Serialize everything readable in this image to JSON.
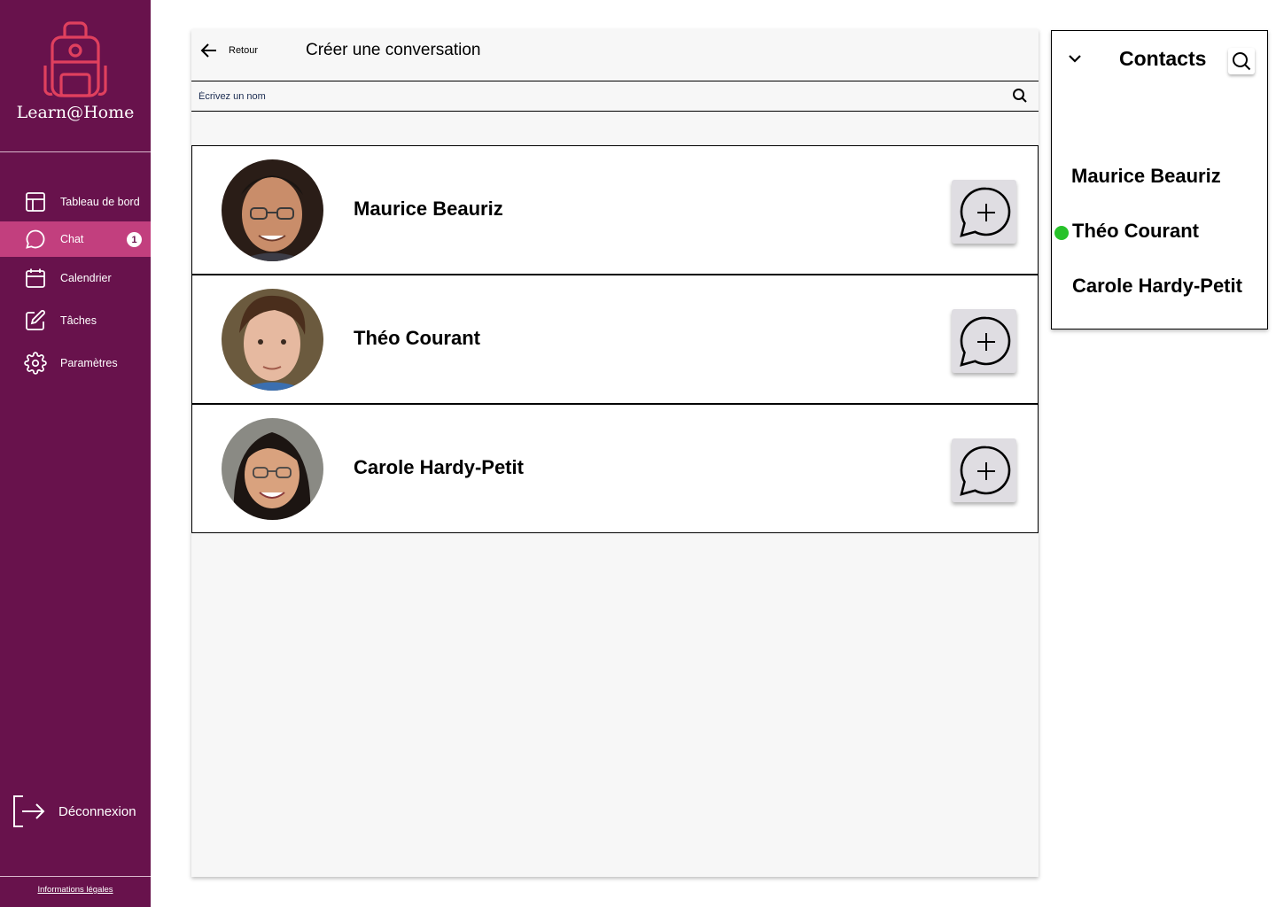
{
  "app": {
    "name": "Learn@Home",
    "accent": "#68124c",
    "active_item_color": "#c23f7e"
  },
  "sidebar": {
    "items": [
      {
        "label": "Tableau de bord",
        "icon": "dashboard-icon"
      },
      {
        "label": "Chat",
        "icon": "chat-icon",
        "badge": "1"
      },
      {
        "label": "Calendrier",
        "icon": "calendar-icon"
      },
      {
        "label": "Tâches",
        "icon": "edit-icon"
      },
      {
        "label": "Paramètres",
        "icon": "gear-icon"
      }
    ],
    "logout_label": "Déconnexion",
    "legal_label": "Informations légales"
  },
  "main": {
    "back_label": "Retour",
    "title": "Créer une conversation",
    "search": {
      "placeholder": "Écrivez un nom",
      "value": ""
    },
    "contacts": [
      {
        "name": "Maurice Beauriz"
      },
      {
        "name": "Théo Courant"
      },
      {
        "name": "Carole Hardy-Petit"
      }
    ]
  },
  "contacts_panel": {
    "title": "Contacts",
    "items": [
      {
        "name": "Maurice Beauriz",
        "online": false
      },
      {
        "name": "Théo Courant",
        "online": true
      },
      {
        "name": "Carole Hardy-Petit",
        "online": false
      }
    ],
    "online_color": "#27c22a"
  }
}
